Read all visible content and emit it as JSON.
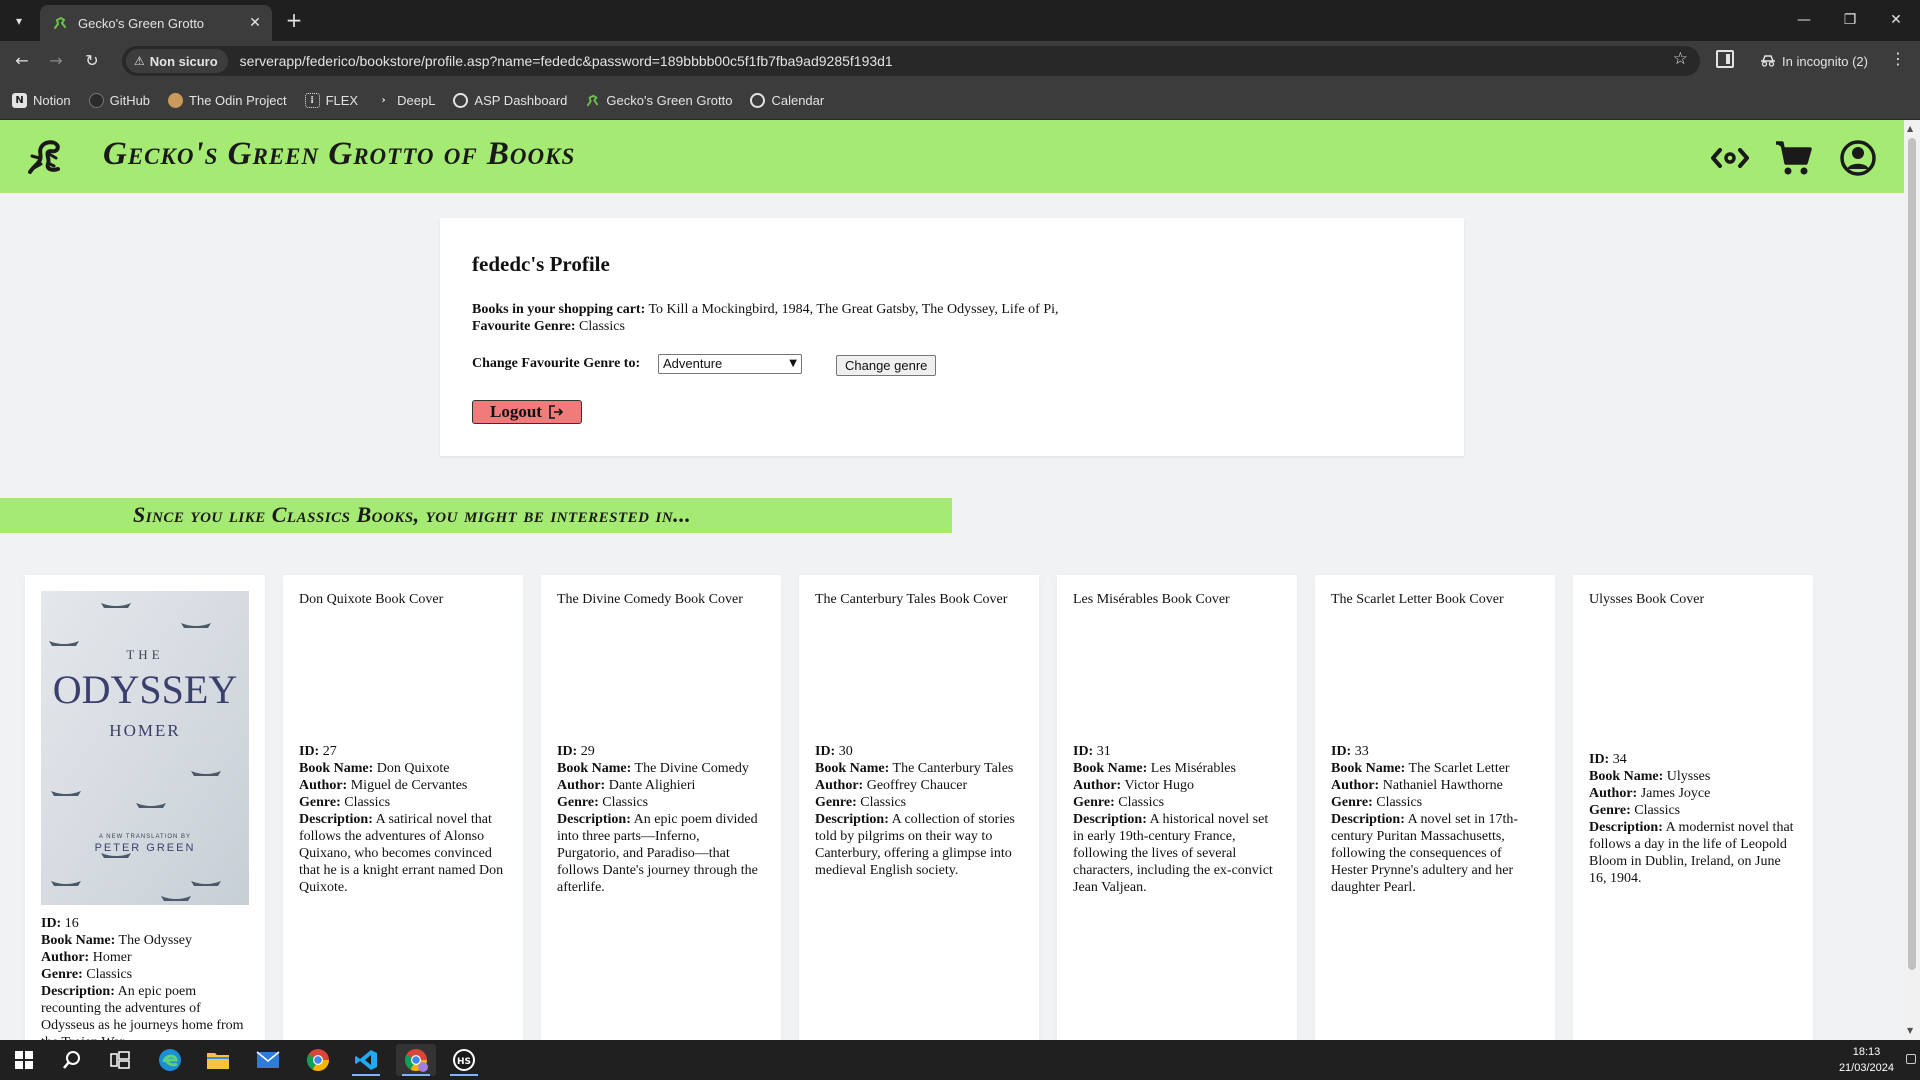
{
  "browser": {
    "tab_title": "Gecko's Green Grotto",
    "security_label": "Non sicuro",
    "url": "serverapp/federico/bookstore/profile.asp?name=fededc&password=189bbbb00c5f1fb7fba9ad9285f193d1",
    "incognito_label": "In incognito (2)",
    "bookmarks": [
      {
        "label": "Notion",
        "icon": "notion-icon"
      },
      {
        "label": "GitHub",
        "icon": "github-icon"
      },
      {
        "label": "The Odin Project",
        "icon": "odin-icon"
      },
      {
        "label": "FLEX",
        "icon": "flex-icon"
      },
      {
        "label": "DeepL",
        "icon": "deepl-icon"
      },
      {
        "label": "ASP Dashboard",
        "icon": "globe-icon"
      },
      {
        "label": "Gecko's Green Grotto",
        "icon": "gecko-icon"
      },
      {
        "label": "Calendar",
        "icon": "globe-icon"
      }
    ]
  },
  "site": {
    "title": "Gecko's Green Grotto of Books",
    "brand_color": "#a5ea72"
  },
  "profile": {
    "heading": "fededc's Profile",
    "cart_label": "Books in your shopping cart:",
    "cart_value": "To Kill a Mockingbird, 1984, The Great Gatsby, The Odyssey, Life of Pi,",
    "genre_label": "Favourite Genre:",
    "genre_value": "Classics",
    "change_label": "Change Favourite Genre to:",
    "select_value": "Adventure",
    "change_button": "Change genre",
    "logout_button": "Logout"
  },
  "recommend": {
    "banner": "Since you like Classics Books, you might be interested in..."
  },
  "labels": {
    "id": "ID:",
    "name": "Book Name:",
    "author": "Author:",
    "genre": "Genre:",
    "description": "Description:"
  },
  "odyssey_cover_text": {
    "the": "THE",
    "title": "ODYSSEY",
    "author": "HOMER",
    "line1": "A NEW TRANSLATION BY",
    "line2": "PETER GREEN"
  },
  "books": [
    {
      "cover_alt": "",
      "id": "16",
      "name": "The Odyssey",
      "author": "Homer",
      "genre": "Classics",
      "description": "An epic poem recounting the adventures of Odysseus as he journeys home from the Trojan War."
    },
    {
      "cover_alt": "Don Quixote Book Cover",
      "id": "27",
      "name": "Don Quixote",
      "author": "Miguel de Cervantes",
      "genre": "Classics",
      "description": "A satirical novel that follows the adventures of Alonso Quixano, who becomes convinced that he is a knight errant named Don Quixote."
    },
    {
      "cover_alt": "The Divine Comedy Book Cover",
      "id": "29",
      "name": "The Divine Comedy",
      "author": "Dante Alighieri",
      "genre": "Classics",
      "description": "An epic poem divided into three parts—Inferno, Purgatorio, and Paradiso—that follows Dante's journey through the afterlife."
    },
    {
      "cover_alt": "The Canterbury Tales Book Cover",
      "id": "30",
      "name": "The Canterbury Tales",
      "author": "Geoffrey Chaucer",
      "genre": "Classics",
      "description": "A collection of stories told by pilgrims on their way to Canterbury, offering a glimpse into medieval English society."
    },
    {
      "cover_alt": "Les Misérables Book Cover",
      "id": "31",
      "name": "Les Misérables",
      "author": "Victor Hugo",
      "genre": "Classics",
      "description": "A historical novel set in early 19th-century France, following the lives of several characters, including the ex-convict Jean Valjean."
    },
    {
      "cover_alt": "The Scarlet Letter Book Cover",
      "id": "33",
      "name": "The Scarlet Letter",
      "author": "Nathaniel Hawthorne",
      "genre": "Classics",
      "description": "A novel set in 17th-century Puritan Massachusetts, following the consequences of Hester Prynne's adultery and her daughter Pearl."
    },
    {
      "cover_alt": "Ulysses Book Cover",
      "id": "34",
      "name": "Ulysses",
      "author": "James Joyce",
      "genre": "Classics",
      "description": "A modernist novel that follows a day in the life of Leopold Bloom in Dublin, Ireland, on June 16, 1904."
    }
  ],
  "taskbar": {
    "time": "18:13",
    "date": "21/03/2024"
  }
}
